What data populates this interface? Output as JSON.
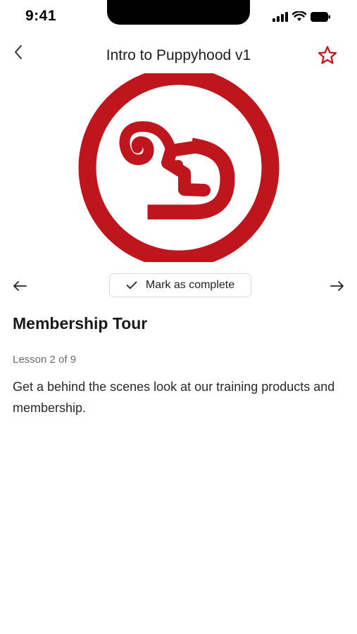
{
  "status_bar": {
    "time": "9:41"
  },
  "header": {
    "title": "Intro to Puppyhood v1",
    "back_icon": "chevron-left-icon",
    "favorite_icon": "star-outline-icon"
  },
  "lesson": {
    "mark_complete_label": "Mark as complete",
    "title": "Membership Tour",
    "progress": "Lesson 2 of 9",
    "description": "Get a behind the scenes look at our training products and membership."
  },
  "colors": {
    "brand_red": "#bf161d",
    "text": "#1f1f1f",
    "muted": "#6b6b6b",
    "border": "#d9d9d9"
  }
}
